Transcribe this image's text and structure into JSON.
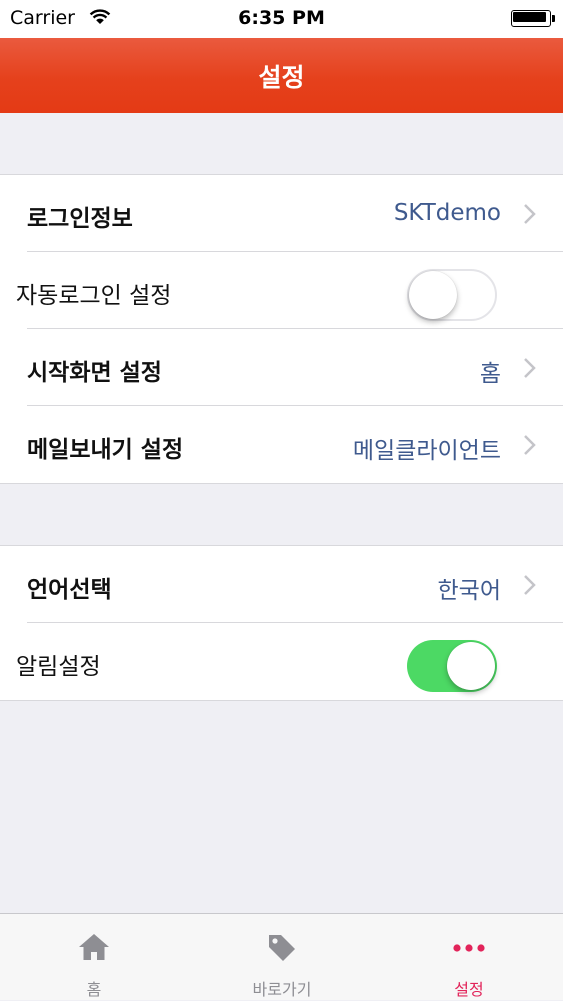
{
  "status_bar": {
    "carrier": "Carrier",
    "time": "6:35 PM"
  },
  "nav": {
    "title": "설정"
  },
  "groups": [
    {
      "rows": [
        {
          "label": "로그인정보",
          "value": "SKTdemo",
          "type": "disclosure"
        },
        {
          "label": "자동로그인 설정",
          "type": "toggle",
          "on": false
        },
        {
          "label": "시작화면 설정",
          "value": "홈",
          "type": "disclosure"
        },
        {
          "label": "메일보내기 설정",
          "value": "메일클라이언트",
          "type": "disclosure"
        }
      ]
    },
    {
      "rows": [
        {
          "label": "언어선택",
          "value": "한국어",
          "type": "disclosure"
        },
        {
          "label": "알림설정",
          "type": "toggle",
          "on": true
        }
      ]
    }
  ],
  "tab_bar": {
    "tabs": [
      {
        "label": "홈",
        "icon": "home-icon"
      },
      {
        "label": "바로가기",
        "icon": "tag-icon"
      },
      {
        "label": "설정",
        "icon": "more-icon",
        "active": true
      }
    ]
  },
  "colors": {
    "nav_bar": "#e5411c",
    "value_text": "#3f5a8e",
    "toggle_on": "#4cd964",
    "tab_active": "#e2245a",
    "tab_inactive": "#8e8e93"
  }
}
